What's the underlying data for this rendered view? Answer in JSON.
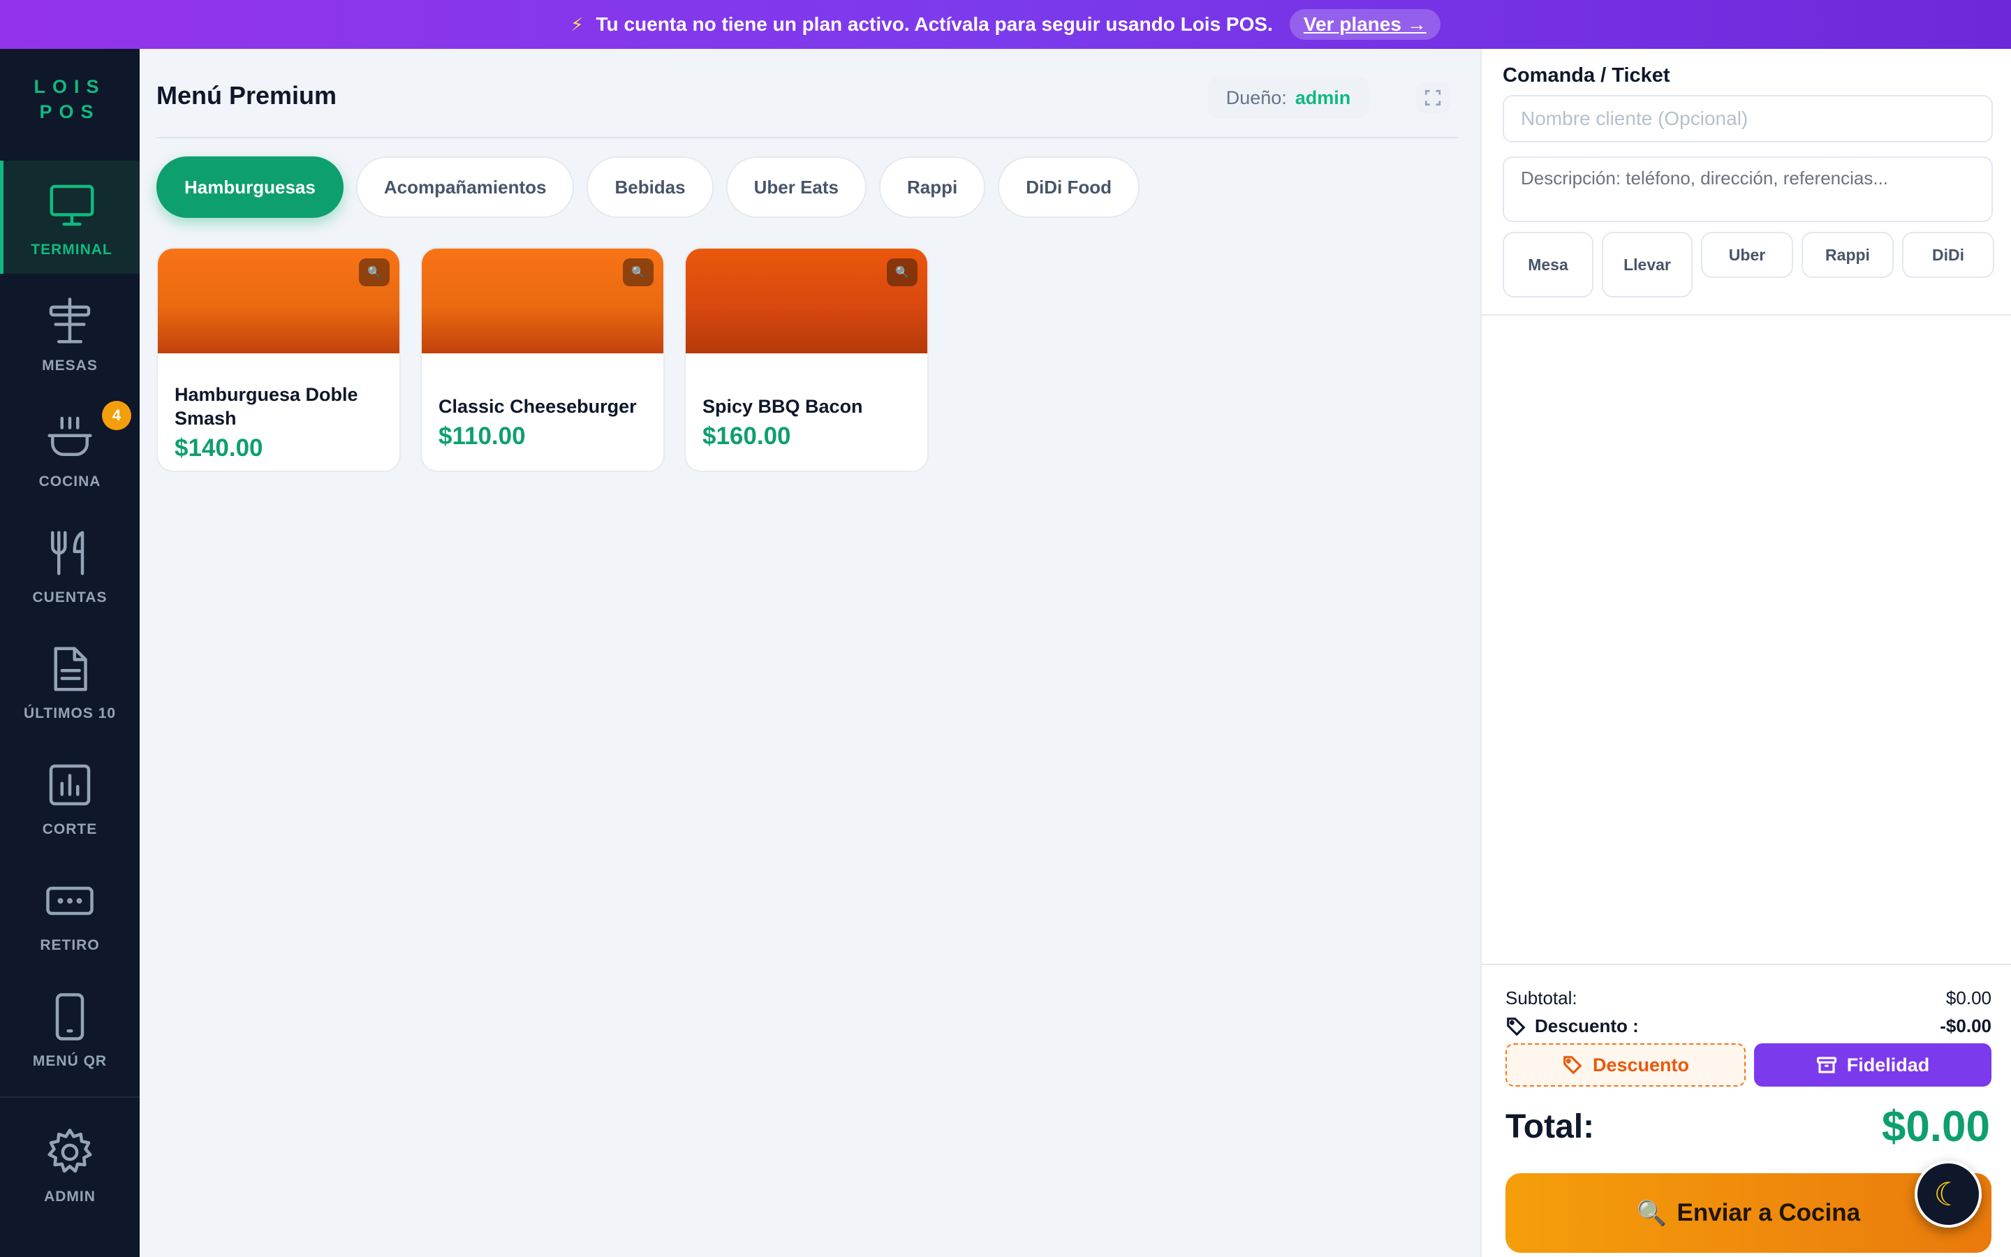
{
  "banner": {
    "text": "Tu cuenta no tiene un plan activo. Actívala para seguir usando Lois POS.",
    "link": "Ver planes →"
  },
  "sidebar": {
    "logo_line1": "LOIS",
    "logo_line2": "POS",
    "items": [
      {
        "label": "TERMINAL",
        "icon": "monitor-icon"
      },
      {
        "label": "MESAS",
        "icon": "table-icon"
      },
      {
        "label": "COCINA",
        "icon": "cooking-pot-icon",
        "badge": "4"
      },
      {
        "label": "CUENTAS",
        "icon": "utensils-icon"
      },
      {
        "label": "ÚLTIMOS 10",
        "icon": "document-icon"
      },
      {
        "label": "CORTE",
        "icon": "bar-chart-icon"
      },
      {
        "label": "RETIRO",
        "icon": "cash-icon"
      },
      {
        "label": "MENÚ QR",
        "icon": "phone-icon"
      },
      {
        "label": "ADMIN",
        "icon": "gear-icon"
      }
    ]
  },
  "main": {
    "title": "Menú Premium",
    "owner_label": "Dueño:",
    "owner_value": "admin",
    "categories": [
      "Hamburguesas",
      "Acompañamientos",
      "Bebidas",
      "Uber Eats",
      "Rappi",
      "DiDi Food"
    ],
    "products": [
      {
        "name": "Hamburguesa Doble Smash",
        "price": "$140.00"
      },
      {
        "name": "Classic Cheeseburger",
        "price": "$110.00"
      },
      {
        "name": "Spicy BBQ Bacon",
        "price": "$160.00"
      }
    ]
  },
  "ticket": {
    "title": "Comanda / Ticket",
    "name_placeholder": "Nombre cliente (Opcional)",
    "desc_placeholder": "Descripción: teléfono, dirección, referencias...",
    "types": [
      "Mesa",
      "Llevar",
      "Uber",
      "Rappi",
      "DiDi"
    ],
    "subtotal_label": "Subtotal:",
    "subtotal_value": "$0.00",
    "discount_label": "Descuento :",
    "discount_value": "-$0.00",
    "discount_button": "Descuento",
    "loyalty_button": "Fidelidad",
    "total_label": "Total:",
    "total_value": "$0.00",
    "send_button": "Enviar a Cocina"
  },
  "colors": {
    "accent": "#10b981",
    "banner": "#7c3aed",
    "sidebar": "#0f172a",
    "send": "#f59e0b"
  }
}
